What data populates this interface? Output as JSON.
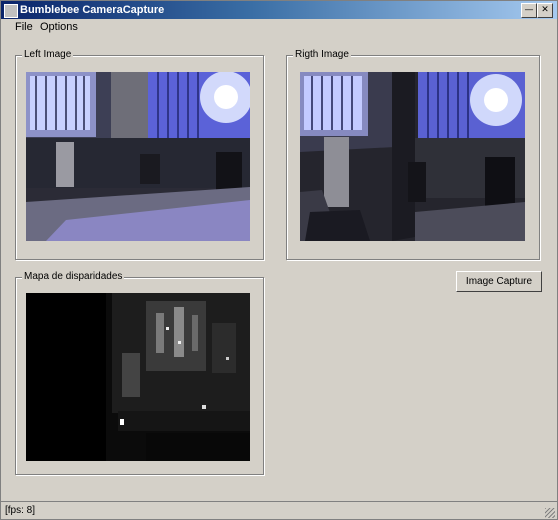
{
  "window": {
    "title": "Bumblebee CameraCapture",
    "minimize_icon": "minimize-icon",
    "close_icon": "close-icon"
  },
  "menu": {
    "items": [
      "File",
      "Options"
    ]
  },
  "groups": {
    "left": "Left Image",
    "right": "Rigth Image",
    "disparity": "Mapa de disparidades"
  },
  "buttons": {
    "capture": "Image Capture"
  },
  "status": {
    "text": "[fps: 8]"
  },
  "colors": {
    "titlebar_left": "#0a246a",
    "titlebar_right": "#a6caf0",
    "window": "#d4d0c8"
  }
}
